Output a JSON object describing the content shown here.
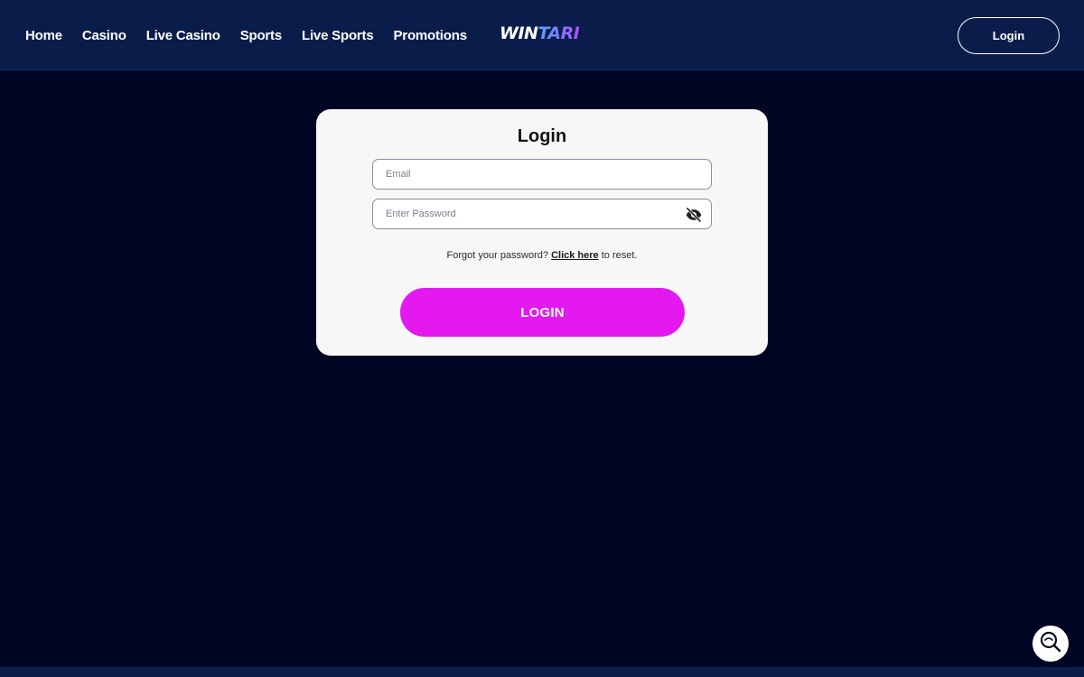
{
  "header": {
    "nav": [
      "Home",
      "Casino",
      "Live Casino",
      "Sports",
      "Live Sports",
      "Promotions"
    ],
    "logo": {
      "part1": "WIN",
      "part2": "TARI"
    },
    "login_label": "Login"
  },
  "login_card": {
    "title": "Login",
    "email_placeholder": "Email",
    "password_placeholder": "Enter Password",
    "forgot_prefix": "Forgot your password?",
    "forgot_link": "Click here",
    "forgot_suffix": "to reset.",
    "submit_label": "LOGIN"
  },
  "icons": {
    "password_toggle": "eye-slash-icon",
    "search": "search-icon"
  },
  "colors": {
    "background": "#010524",
    "header": "#0a1d4a",
    "accent": "#e319f0",
    "card": "#f7f7f8"
  }
}
